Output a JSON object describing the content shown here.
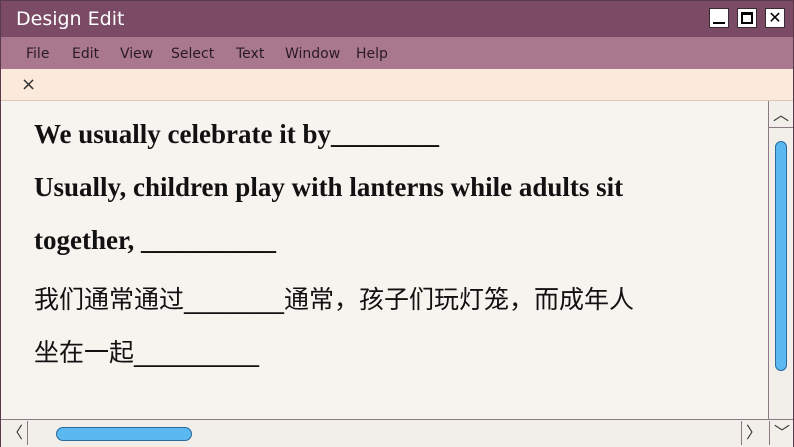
{
  "window": {
    "title": "Design Edit",
    "controls": {
      "minimize": "",
      "maximize": "",
      "close": "✕"
    }
  },
  "menu": {
    "items": [
      "File",
      "Edit",
      "View",
      "Select",
      "Text",
      "Window",
      "Help"
    ]
  },
  "tabbar": {
    "close_glyph": "×"
  },
  "document": {
    "lines": [
      "We usually celebrate it by________",
      "Usually, children play with lanterns while adults sit",
      "together, __________",
      "我们通常通过________通常，孩子们玩灯笼，而成年人",
      "坐在一起__________"
    ]
  },
  "scrollbars": {
    "up": "︿",
    "down": "﹀",
    "left": "〈",
    "right": "〉"
  },
  "colors": {
    "titlebar": "#7b4a64",
    "menubar": "#a9788f",
    "tabbar": "#fbeadb",
    "canvas": "#f7f3ee",
    "scroll_thumb": "#5bb8f0"
  }
}
